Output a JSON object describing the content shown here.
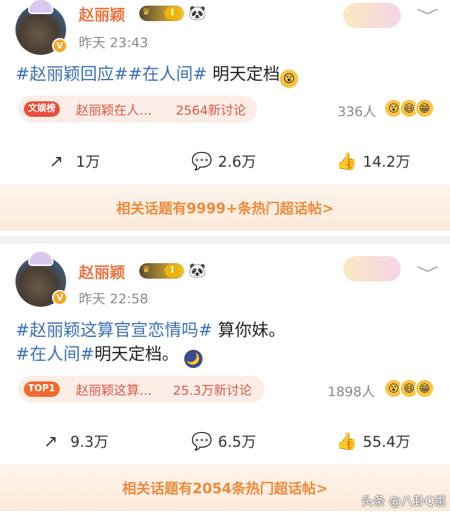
{
  "posts": [
    {
      "username": "赵丽颖",
      "rank_level": "I",
      "panda": "🐼",
      "verified_badge": "V",
      "time": "昨天 23:43",
      "content": {
        "hashtags": [
          "#赵丽颖回应#",
          "#在人间#"
        ],
        "text": " 明天定档",
        "emoji": "😮"
      },
      "topic": {
        "tag": "文娱榜",
        "text": "赵丽颖在人…",
        "count": "2564新讨论"
      },
      "read_count": "336人",
      "actions": {
        "share": "1万",
        "comment": "2.6万",
        "like": "14.2万"
      },
      "hot_topics_link": "相关话题有9999+条热门超话帖>"
    },
    {
      "username": "赵丽颖",
      "rank_level": "I",
      "panda": "🐼",
      "verified_badge": "V",
      "time": "昨天 22:58",
      "content": {
        "line1_hashtag": "#赵丽颖这算官宣恋情吗#",
        "line1_text": " 算你妹。",
        "line2_hashtag": "#在人间#",
        "line2_text": "明天定档。",
        "emoji": "🌙"
      },
      "topic": {
        "tag": "TOP1",
        "text": "赵丽颖这算…",
        "count": "25.3万新讨论"
      },
      "read_count": "1898人",
      "actions": {
        "share": "9.3万",
        "comment": "6.5万",
        "like": "55.4万"
      },
      "hot_topics_link": "相关话题有2054条热门超话帖>"
    }
  ],
  "icons": {
    "share": "share-icon",
    "comment": "comment-icon",
    "like": "thumbs-up-icon",
    "chevron": "chevron-down-icon"
  },
  "watermark": "头条 @八卦Q崽",
  "colors": {
    "username": "#eb7340",
    "hashtag": "#3a6fb5",
    "topic_text": "#d85a48",
    "hot_link": "#ee8a3c"
  }
}
